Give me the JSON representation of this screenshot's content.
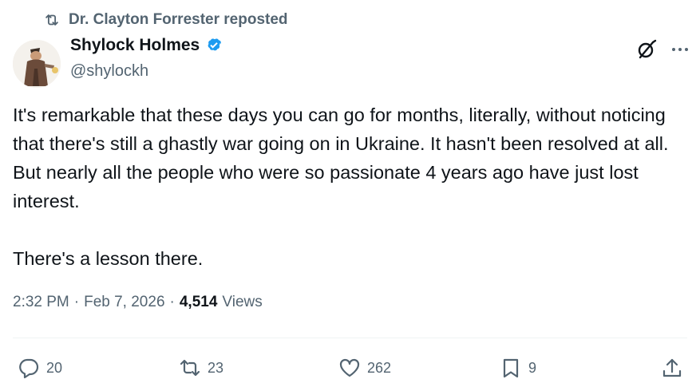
{
  "repost": {
    "label": "Dr. Clayton Forrester reposted"
  },
  "author": {
    "name": "Shylock Holmes",
    "handle": "@shylockh",
    "verified_color": "#1d9bf0"
  },
  "tweet": {
    "paragraphs": [
      "It's remarkable that these days you can go for months, literally, without noticing that there's still a ghastly war going on in Ukraine. It hasn't been resolved at all. But nearly all the people who were so passionate 4 years ago have just lost interest.",
      "There's a lesson there."
    ],
    "time": "2:32 PM",
    "date": "Feb 7, 2026",
    "views_count": "4,514",
    "views_label": "Views"
  },
  "actions": {
    "replies": "20",
    "reposts": "23",
    "likes": "262",
    "bookmarks": "9"
  },
  "icons": {
    "repost": "repost-icon",
    "verified": "verified-badge-icon",
    "grok": "grok-icon",
    "more": "more-icon",
    "reply": "reply-icon",
    "like": "heart-icon",
    "bookmark": "bookmark-icon",
    "share": "share-icon"
  },
  "colors": {
    "text": "#0f1419",
    "secondary": "#536471",
    "accent": "#1d9bf0",
    "divider": "#eff3f4"
  }
}
